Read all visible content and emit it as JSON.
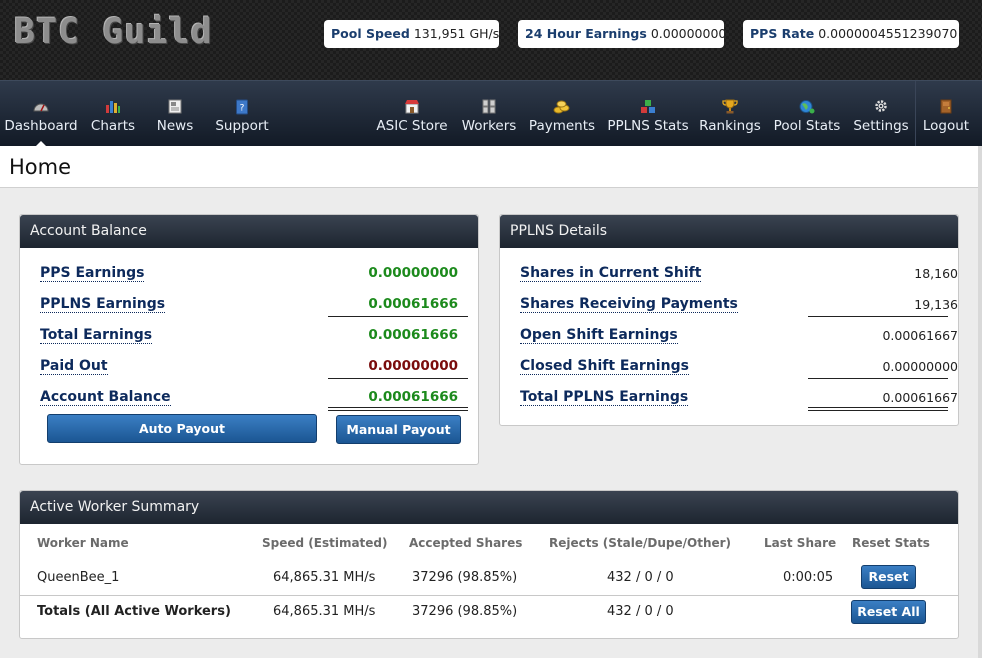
{
  "header": {
    "logo_text": "BTC Guild",
    "stats": [
      {
        "label": "Pool Speed",
        "value": "131,951 GH/s"
      },
      {
        "label": "24 Hour Earnings",
        "value": "0.00000000"
      },
      {
        "label": "PPS Rate",
        "value": "0.0000004551239070"
      }
    ]
  },
  "nav": {
    "left": [
      {
        "label": "Dashboard",
        "icon": "gauge-icon",
        "active": true
      },
      {
        "label": "Charts",
        "icon": "bar-chart-icon"
      },
      {
        "label": "News",
        "icon": "newspaper-icon"
      },
      {
        "label": "Support",
        "icon": "help-book-icon"
      }
    ],
    "right": [
      {
        "label": "ASIC Store",
        "icon": "store-icon"
      },
      {
        "label": "Workers",
        "icon": "workers-icon"
      },
      {
        "label": "Payments",
        "icon": "coins-icon"
      },
      {
        "label": "PPLNS Stats",
        "icon": "blocks-icon"
      },
      {
        "label": "Rankings",
        "icon": "trophy-icon"
      },
      {
        "label": "Pool Stats",
        "icon": "globe-icon"
      },
      {
        "label": "Settings",
        "icon": "gear-icon"
      },
      {
        "label": "Logout",
        "icon": "door-icon"
      }
    ]
  },
  "page": {
    "title": "Home"
  },
  "account_balance": {
    "title": "Account Balance",
    "rows": [
      {
        "label": "PPS Earnings",
        "value": "0.00000000",
        "color": "#1c8a1c"
      },
      {
        "label": "PPLNS Earnings",
        "value": "0.00061666",
        "color": "#1c8a1c"
      },
      {
        "label": "Total Earnings",
        "value": "0.00061666",
        "color": "#1c8a1c"
      },
      {
        "label": "Paid Out",
        "value": "0.00000000",
        "color": "#7a0c0c"
      },
      {
        "label": "Account Balance",
        "value": "0.00061666",
        "color": "#1c8a1c"
      }
    ],
    "auto_payout_label": "Auto Payout",
    "manual_payout_label": "Manual Payout"
  },
  "pplns_details": {
    "title": "PPLNS Details",
    "rows": [
      {
        "label": "Shares in Current Shift",
        "value": "18,160"
      },
      {
        "label": "Shares Receiving Payments",
        "value": "19,136"
      },
      {
        "label": "Open Shift Earnings",
        "value": "0.00061667"
      },
      {
        "label": "Closed Shift Earnings",
        "value": "0.00000000"
      },
      {
        "label": "Total PPLNS Earnings",
        "value": "0.00061667"
      }
    ]
  },
  "workers": {
    "title": "Active Worker Summary",
    "columns": [
      "Worker Name",
      "Speed (Estimated)",
      "Accepted Shares",
      "Rejects (Stale/Dupe/Other)",
      "Last Share",
      "Reset Stats"
    ],
    "rows": [
      {
        "name": "QueenBee_1",
        "speed": "64,865.31 MH/s",
        "accepted": "37296 (98.85%)",
        "rejects": "432 / 0 / 0",
        "last_share": "0:00:05",
        "action": "Reset"
      }
    ],
    "totals": {
      "name": "Totals (All Active Workers)",
      "speed": "64,865.31 MH/s",
      "accepted": "37296 (98.85%)",
      "rejects": "432 / 0 / 0",
      "action": "Reset All"
    }
  }
}
